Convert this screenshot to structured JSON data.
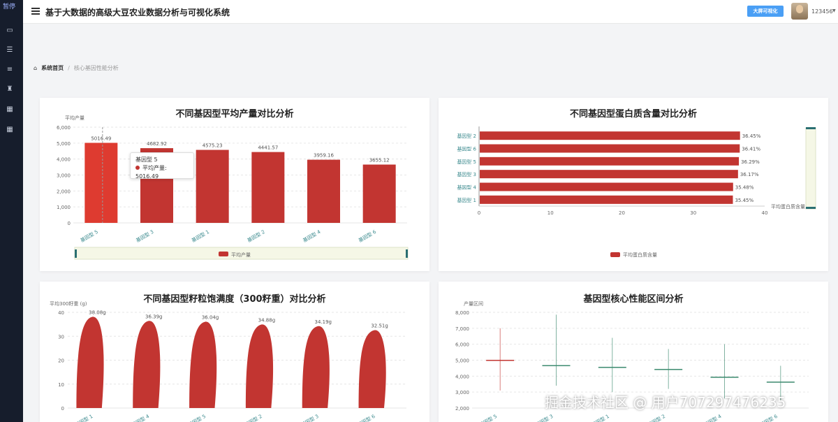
{
  "sidebar": {
    "logo": "暂停",
    "icons": [
      "home-icon",
      "window-icon",
      "sliders-icon",
      "list-icon",
      "trophy-icon",
      "grid-icon",
      "grid-icon"
    ]
  },
  "header": {
    "title": "基于大数据的高级大豆农业数据分析与可视化系统",
    "bigscreen_label": "大屏可视化",
    "username": "123456"
  },
  "breadcrumb": {
    "home": "系统首页",
    "current": "核心基因性能分析"
  },
  "colors": {
    "bar": "#c23531",
    "accent": "#4a9ff5",
    "candle_up": "#c23531",
    "candle_down": "#3b8a6e"
  },
  "charts": [
    {
      "title": "不同基因型平均产量对比分析",
      "type": "bar",
      "ylabel": "平均产量",
      "categories": [
        "基因型 5",
        "基因型 3",
        "基因型 1",
        "基因型 2",
        "基因型 4",
        "基因型 6"
      ],
      "values": [
        5016.49,
        4682.92,
        4575.23,
        4441.57,
        3959.16,
        3655.12
      ],
      "value_labels": [
        "5016.49",
        "4682.92",
        "4575.23",
        "4441.57",
        "3959.16",
        "3655.12"
      ],
      "yticks": [
        "0",
        "1,000",
        "2,000",
        "3,000",
        "4,000",
        "5,000",
        "6,000"
      ],
      "ylim": [
        0,
        6000
      ],
      "legend": "平均产量",
      "tooltip": {
        "title": "基因型 5",
        "series": "平均产量",
        "value": "5016.49"
      }
    },
    {
      "title": "不同基因型蛋白质含量对比分析",
      "type": "bar",
      "orientation": "horizontal",
      "categories": [
        "基因型 2",
        "基因型 6",
        "基因型 5",
        "基因型 3",
        "基因型 4",
        "基因型 1"
      ],
      "values": [
        36.45,
        36.41,
        36.29,
        36.17,
        35.48,
        35.45
      ],
      "value_labels": [
        "36.45%",
        "36.41%",
        "36.29%",
        "36.17%",
        "35.48%",
        "35.45%"
      ],
      "xticks": [
        "0",
        "10",
        "20",
        "30",
        "40"
      ],
      "xlim": [
        0,
        40
      ],
      "legend": "平均蛋白质含量",
      "zoom_label": "平均蛋白质含量"
    },
    {
      "title": "不同基因型籽粒饱满度（300籽重）对比分析",
      "type": "bar",
      "ylabel": "平均300籽重 (g)",
      "categories": [
        "基因型 1",
        "基因型 4",
        "基因型 5",
        "基因型 2",
        "基因型 3",
        "基因型 6"
      ],
      "values": [
        38.08,
        36.39,
        36.04,
        34.88,
        34.19,
        32.51
      ],
      "value_labels": [
        "38.08g",
        "36.39g",
        "36.04g",
        "34.88g",
        "34.19g",
        "32.51g"
      ],
      "yticks": [
        "0",
        "10",
        "20",
        "30",
        "40"
      ],
      "ylim": [
        0,
        40
      ]
    },
    {
      "title": "基因型核心性能区间分析",
      "type": "candlestick",
      "ylabel": "产量区间",
      "categories": [
        "基因型 5",
        "基因型 3",
        "基因型 1",
        "基因型 2",
        "基因型 4",
        "基因型 6"
      ],
      "open": [
        5020,
        4680,
        4580,
        4440,
        3960,
        3655
      ],
      "close": [
        5010,
        4690,
        4570,
        4450,
        3955,
        3650
      ],
      "low": [
        3100,
        3400,
        3000,
        3200,
        2600,
        2500
      ],
      "high": [
        7000,
        7850,
        6400,
        5700,
        6000,
        4650
      ],
      "yticks": [
        "2,000",
        "3,000",
        "4,000",
        "5,000",
        "6,000",
        "7,000",
        "8,000"
      ],
      "ylim": [
        2000,
        8000
      ]
    }
  ],
  "watermark": "掘金技术社区 @ 用户707297476235"
}
